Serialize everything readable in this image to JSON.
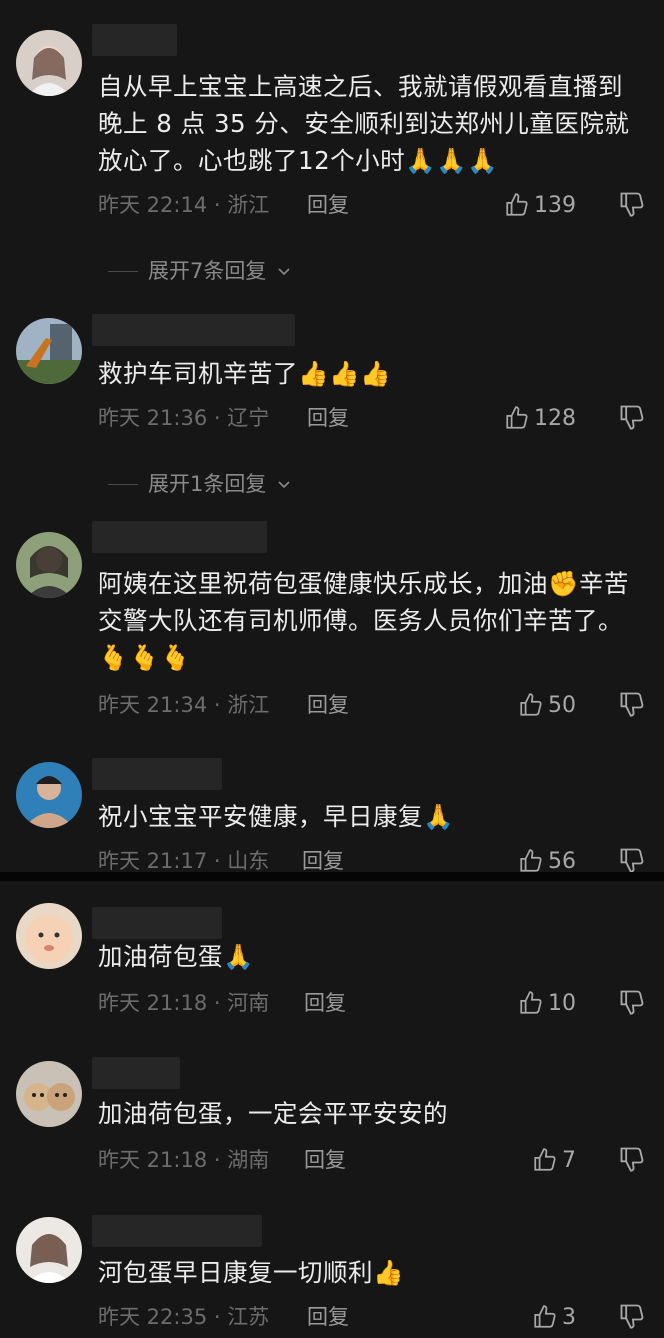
{
  "reply_label": "回复",
  "comments_top": [
    {
      "text": "自从早上宝宝上高速之后、我就请假观看直播到晚上 8 点 35 分、安全顺利到达郑州儿童医院就放心了。心也跳了12个小时🙏🙏🙏",
      "meta": "昨天 22:14 · 浙江",
      "likes": "139",
      "expand": "展开7条回复"
    },
    {
      "text": "救护车司机辛苦了👍👍👍",
      "meta": "昨天 21:36 · 辽宁",
      "likes": "128",
      "expand": "展开1条回复"
    },
    {
      "text": "阿姨在这里祝荷包蛋健康快乐成长，加油✊辛苦交警大队还有司机师傅。医务人员你们辛苦了。🫰🫰🫰",
      "meta": "昨天 21:34 · 浙江",
      "likes": "50"
    },
    {
      "text": "祝小宝宝平安健康，早日康复🙏",
      "meta": "昨天 21:17 · 山东",
      "likes": "56"
    }
  ],
  "comments_bottom": [
    {
      "text": "加油荷包蛋🙏",
      "meta": "昨天 21:18 · 河南",
      "likes": "10"
    },
    {
      "text": "加油荷包蛋，一定会平平安安的",
      "meta": "昨天 21:18 · 湖南",
      "likes": "7"
    },
    {
      "text": "河包蛋早日康复一切顺利👍",
      "meta": "昨天 22:35 · 江苏",
      "likes": "3"
    }
  ],
  "icons": {
    "like": "thumbs-up-icon",
    "dislike": "thumbs-down-icon",
    "expand": "chevron-down-icon"
  }
}
